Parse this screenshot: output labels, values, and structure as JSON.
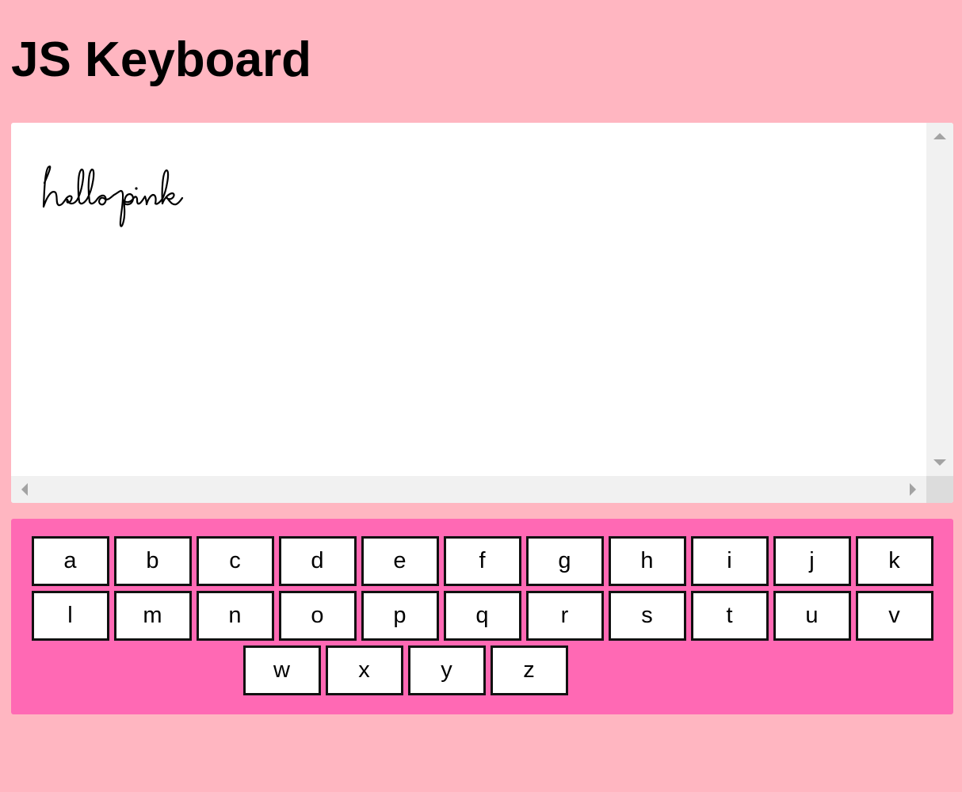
{
  "page": {
    "title": "JS Keyboard"
  },
  "textarea": {
    "value": "hellopink"
  },
  "keyboard": {
    "rows": [
      [
        "a",
        "b",
        "c",
        "d",
        "e",
        "f",
        "g",
        "h",
        "i",
        "j",
        "k"
      ],
      [
        "l",
        "m",
        "n",
        "o",
        "p",
        "q",
        "r",
        "s",
        "t",
        "u",
        "v"
      ],
      [
        "w",
        "x",
        "y",
        "z"
      ]
    ]
  },
  "colors": {
    "page_background": "#ffb6c1",
    "keyboard_background": "#ff69b4",
    "key_background": "#ffffff",
    "key_border": "#111111"
  }
}
